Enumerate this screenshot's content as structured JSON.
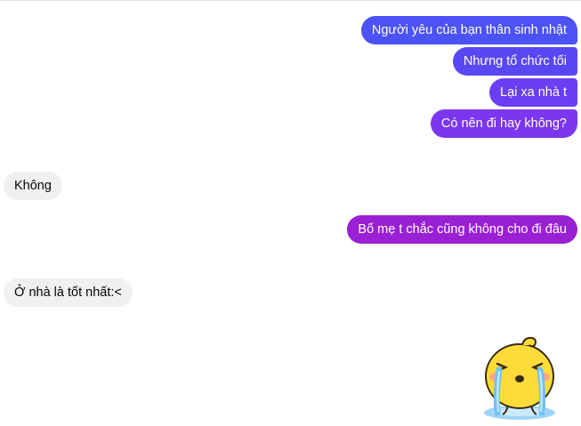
{
  "messages": [
    {
      "text": "Người yêu của bạn thân sinh nhật",
      "color": "#4c52f4"
    },
    {
      "text": "Nhưng tổ chức tối",
      "color": "#5a47f4"
    },
    {
      "text": "Lại xa nhà t",
      "color": "#6a3ef2"
    },
    {
      "text": "Có nên đi hay không?",
      "color": "#7b36ee"
    },
    {
      "text": "Không"
    },
    {
      "text": "Bố mẹ t chắc cũng không cho đi đâu",
      "color": "#9a20d4"
    },
    {
      "text": "Ở nhà là tốt nhất:<"
    }
  ],
  "sticker": {
    "icon": "crying-chick-sticker-icon"
  }
}
